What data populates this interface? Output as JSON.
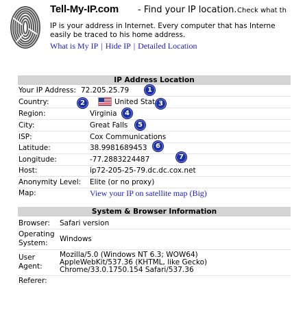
{
  "header": {
    "site_title": "Tell-My-IP.com",
    "tagline": "- Find your IP location.",
    "tagline_cut": "Check what th",
    "intro_line1": "IP is your address in Internet. Every computer that has Interne",
    "intro_line2": "easily be traced to his home address.",
    "nav": [
      "What is My IP",
      "Hide IP",
      "Detailed Location"
    ]
  },
  "ip_section": {
    "title": "IP Address Location",
    "rows": [
      {
        "label": "Your IP Address:",
        "value": "72.205.25.79"
      },
      {
        "label": "Country:",
        "value": "United States"
      },
      {
        "label": "Region:",
        "value": "Virginia"
      },
      {
        "label": "City:",
        "value": "Great Falls"
      },
      {
        "label": "ISP:",
        "value": "Cox Communications"
      },
      {
        "label": "Latitude:",
        "value": "38.9981689453"
      },
      {
        "label": "Longitude:",
        "value": "-77.2883224487"
      },
      {
        "label": "Host:",
        "value": "ip72-205-25-79.dc.dc.cox.net"
      },
      {
        "label": "Anonymity Level:",
        "value": "Elite (or no proxy)"
      },
      {
        "label": "Map:",
        "value": "View your IP on satellite map (Big)"
      }
    ],
    "badges": [
      "1",
      "2",
      "3",
      "4",
      "5",
      "6",
      "7"
    ]
  },
  "system_section": {
    "title": "System & Browser Information",
    "browser_label": "Browser:",
    "browser_value": "Safari version",
    "os_label_1": "Operating",
    "os_label_2": "System:",
    "os_value": "Windows",
    "ua_label_1": "User",
    "ua_label_2": "Agent:",
    "ua_line1": "Mozilla/5.0 (Windows NT 6.3; WOW64)",
    "ua_line2": "AppleWebKit/537.36 (KHTML, like Gecko)",
    "ua_line3": "Chrome/33.0.1750.154 Safari/537.36",
    "referer_label": "Referer:"
  },
  "colors": {
    "badge": "#1b2fa8",
    "link": "#1a1acc",
    "header_bg": "#d4d4d4"
  },
  "icons": {
    "logo": "fingerprint-icon",
    "flag": "us-flag-icon"
  }
}
